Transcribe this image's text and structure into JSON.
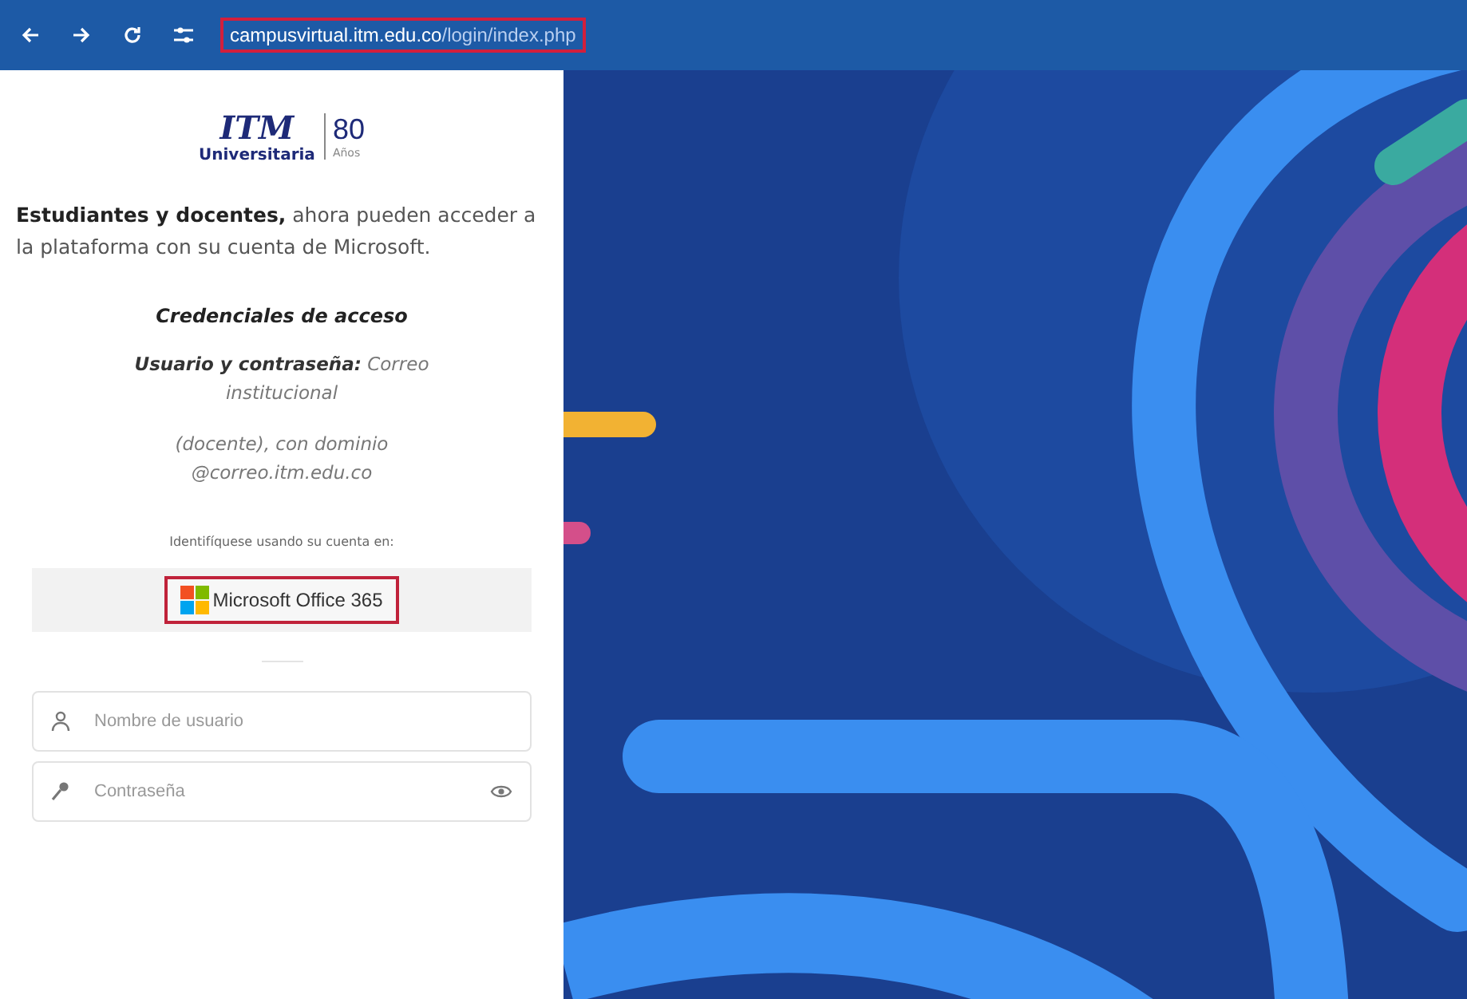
{
  "browser": {
    "url_host": "campusvirtual.itm.edu.co",
    "url_path": "/login/index.php",
    "url_highlighted": true
  },
  "logo": {
    "mark": "ITM",
    "name": "Universitaria",
    "years": "80",
    "years_label": "Años"
  },
  "intro": "**Estudiantes y docentes,** ahora pueden acceder a la plataforma con su cuenta de Microsoft.",
  "credentials": {
    "title": "Credenciales de acceso",
    "line_1": "**Usuario y contraseña:** Correo institucional",
    "line_2": "(docente), con dominio @correo.itm.edu.co"
  },
  "identify_label": "Identifíquese usando su cuenta en:",
  "ms_button": {
    "label": "Microsoft Office 365",
    "highlighted": true
  },
  "fields": [
    {
      "kind": "user",
      "placeholder": "Nombre de usuario"
    },
    {
      "kind": "password",
      "placeholder": "Contraseña"
    }
  ]
}
